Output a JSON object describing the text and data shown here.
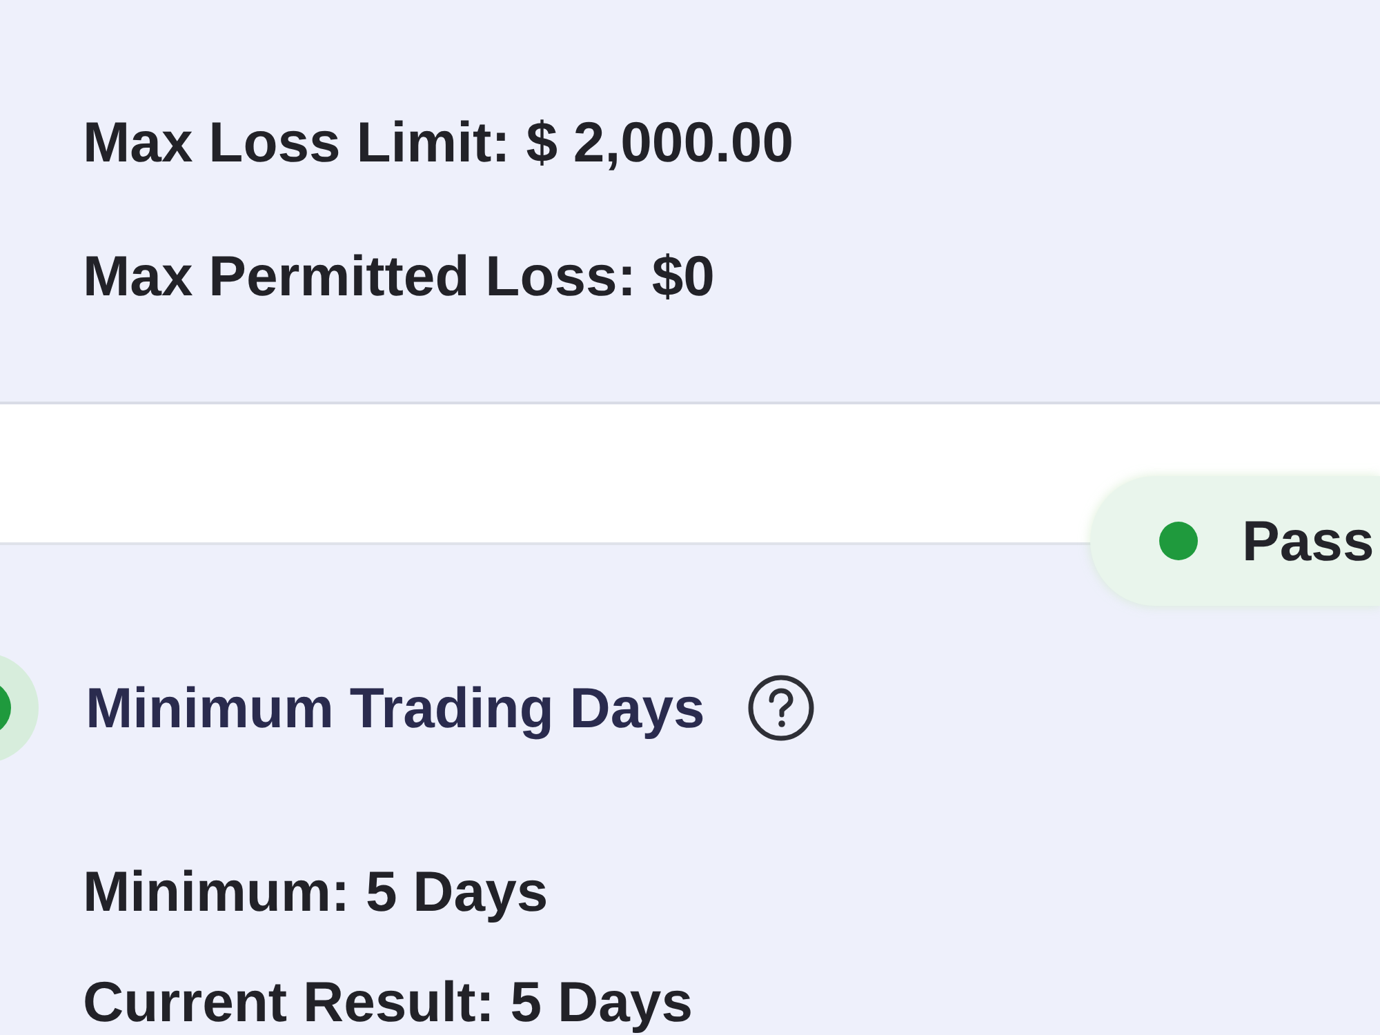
{
  "cards": [
    {
      "lines": [
        "Max Loss Limit: $ 2,000.00",
        "Max Permitted Loss: $0"
      ]
    },
    {
      "color": "#1f9a3d",
      "badge": "Pass",
      "title": "Minimum Trading Days",
      "lines": [
        "Minimum: 5 Days",
        "Current Result: 5 Days"
      ]
    }
  ]
}
